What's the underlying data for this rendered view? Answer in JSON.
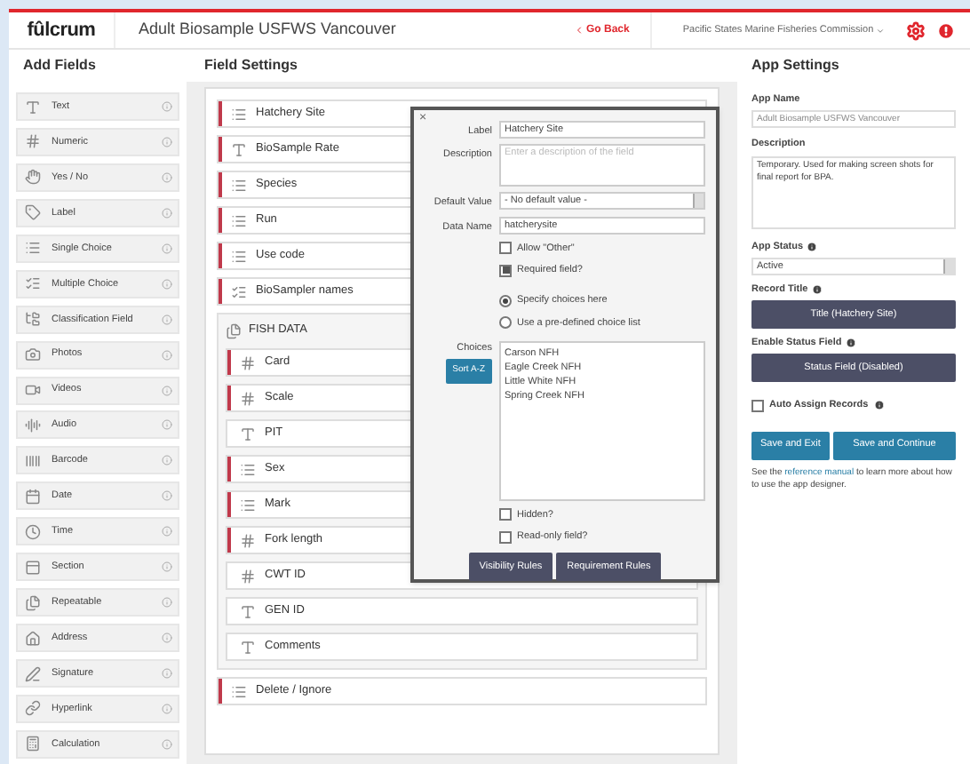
{
  "header": {
    "logo": "fûlcrum",
    "app_title": "Adult Biosample USFWS Vancouver",
    "go_back": "Go Back",
    "organization": "Pacific States Marine Fisheries Commission"
  },
  "add_fields": {
    "title": "Add Fields",
    "items": [
      {
        "label": "Text",
        "kind": "text"
      },
      {
        "label": "Numeric",
        "kind": "numeric"
      },
      {
        "label": "Yes / No",
        "kind": "yesno"
      },
      {
        "label": "Label",
        "kind": "label"
      },
      {
        "label": "Single Choice",
        "kind": "single"
      },
      {
        "label": "Multiple Choice",
        "kind": "multiple"
      },
      {
        "label": "Classification Field",
        "kind": "classification"
      },
      {
        "label": "Photos",
        "kind": "photos"
      },
      {
        "label": "Videos",
        "kind": "videos"
      },
      {
        "label": "Audio",
        "kind": "audio"
      },
      {
        "label": "Barcode",
        "kind": "barcode"
      },
      {
        "label": "Date",
        "kind": "date"
      },
      {
        "label": "Time",
        "kind": "time"
      },
      {
        "label": "Section",
        "kind": "section"
      },
      {
        "label": "Repeatable",
        "kind": "repeatable"
      },
      {
        "label": "Address",
        "kind": "address"
      },
      {
        "label": "Signature",
        "kind": "signature"
      },
      {
        "label": "Hyperlink",
        "kind": "hyperlink"
      },
      {
        "label": "Calculation",
        "kind": "calculation"
      }
    ]
  },
  "field_settings": {
    "title": "Field Settings",
    "fields": [
      {
        "label": "Hatchery Site",
        "kind": "single",
        "required": true
      },
      {
        "label": "BioSample Rate",
        "kind": "text",
        "required": true
      },
      {
        "label": "Species",
        "kind": "single",
        "required": true
      },
      {
        "label": "Run",
        "kind": "single",
        "required": true
      },
      {
        "label": "Use code",
        "kind": "single",
        "required": true
      },
      {
        "label": "BioSampler names",
        "kind": "multiple",
        "required": true
      },
      {
        "label": "FISH DATA",
        "kind": "repeatable",
        "children": [
          {
            "label": "Card",
            "kind": "numeric",
            "required": true
          },
          {
            "label": "Scale",
            "kind": "numeric",
            "required": true
          },
          {
            "label": "PIT",
            "kind": "text",
            "required": false
          },
          {
            "label": "Sex",
            "kind": "single",
            "required": true
          },
          {
            "label": "Mark",
            "kind": "single",
            "required": true
          },
          {
            "label": "Fork length",
            "kind": "numeric",
            "required": true
          },
          {
            "label": "CWT ID",
            "kind": "numeric",
            "required": false
          },
          {
            "label": "GEN ID",
            "kind": "text",
            "required": false
          },
          {
            "label": "Comments",
            "kind": "text",
            "required": false
          }
        ]
      },
      {
        "label": "Delete / Ignore",
        "kind": "single",
        "required": true
      }
    ]
  },
  "editor": {
    "close": "×",
    "label_label": "Label",
    "label_value": "Hatchery Site",
    "description_label": "Description",
    "description_placeholder": "Enter a description of the field",
    "default_label": "Default Value",
    "default_value": "- No default value -",
    "data_name_label": "Data Name",
    "data_name_value": "hatcherysite",
    "checks_top": [
      {
        "label": "Allow \"Other\"",
        "checked": false
      },
      {
        "label": "Required field?",
        "checked": true
      }
    ],
    "radios": [
      {
        "label": "Specify choices here",
        "selected": true
      },
      {
        "label": "Use a pre-defined choice list",
        "selected": false
      }
    ],
    "choices_label": "Choices",
    "sort_button": "Sort A-Z",
    "choices": [
      "Carson NFH",
      "Eagle Creek NFH",
      "Little White NFH",
      "Spring Creek NFH"
    ],
    "checks_bottom": [
      {
        "label": "Hidden?",
        "checked": false
      },
      {
        "label": "Read-only field?",
        "checked": false
      }
    ],
    "buttons": [
      "Visibility Rules",
      "Requirement Rules"
    ]
  },
  "app_settings": {
    "title": "App Settings",
    "app_name_label": "App Name",
    "app_name_value": "Adult Biosample USFWS Vancouver",
    "description_label": "Description",
    "description_value": "Temporary.  Used for making screen shots for final report for BPA.",
    "status_label": "App Status",
    "status_value": "Active",
    "record_title_label": "Record Title",
    "record_title_button": "Title (Hatchery Site)",
    "status_field_label": "Enable Status Field",
    "status_field_button": "Status Field (Disabled)",
    "auto_assign": {
      "label": "Auto Assign Records",
      "checked": false
    },
    "save_exit": "Save and Exit",
    "save_continue": "Save and Continue",
    "help_before": "See the",
    "help_link": "reference manual",
    "help_after": "to learn more about how to use the app designer."
  }
}
